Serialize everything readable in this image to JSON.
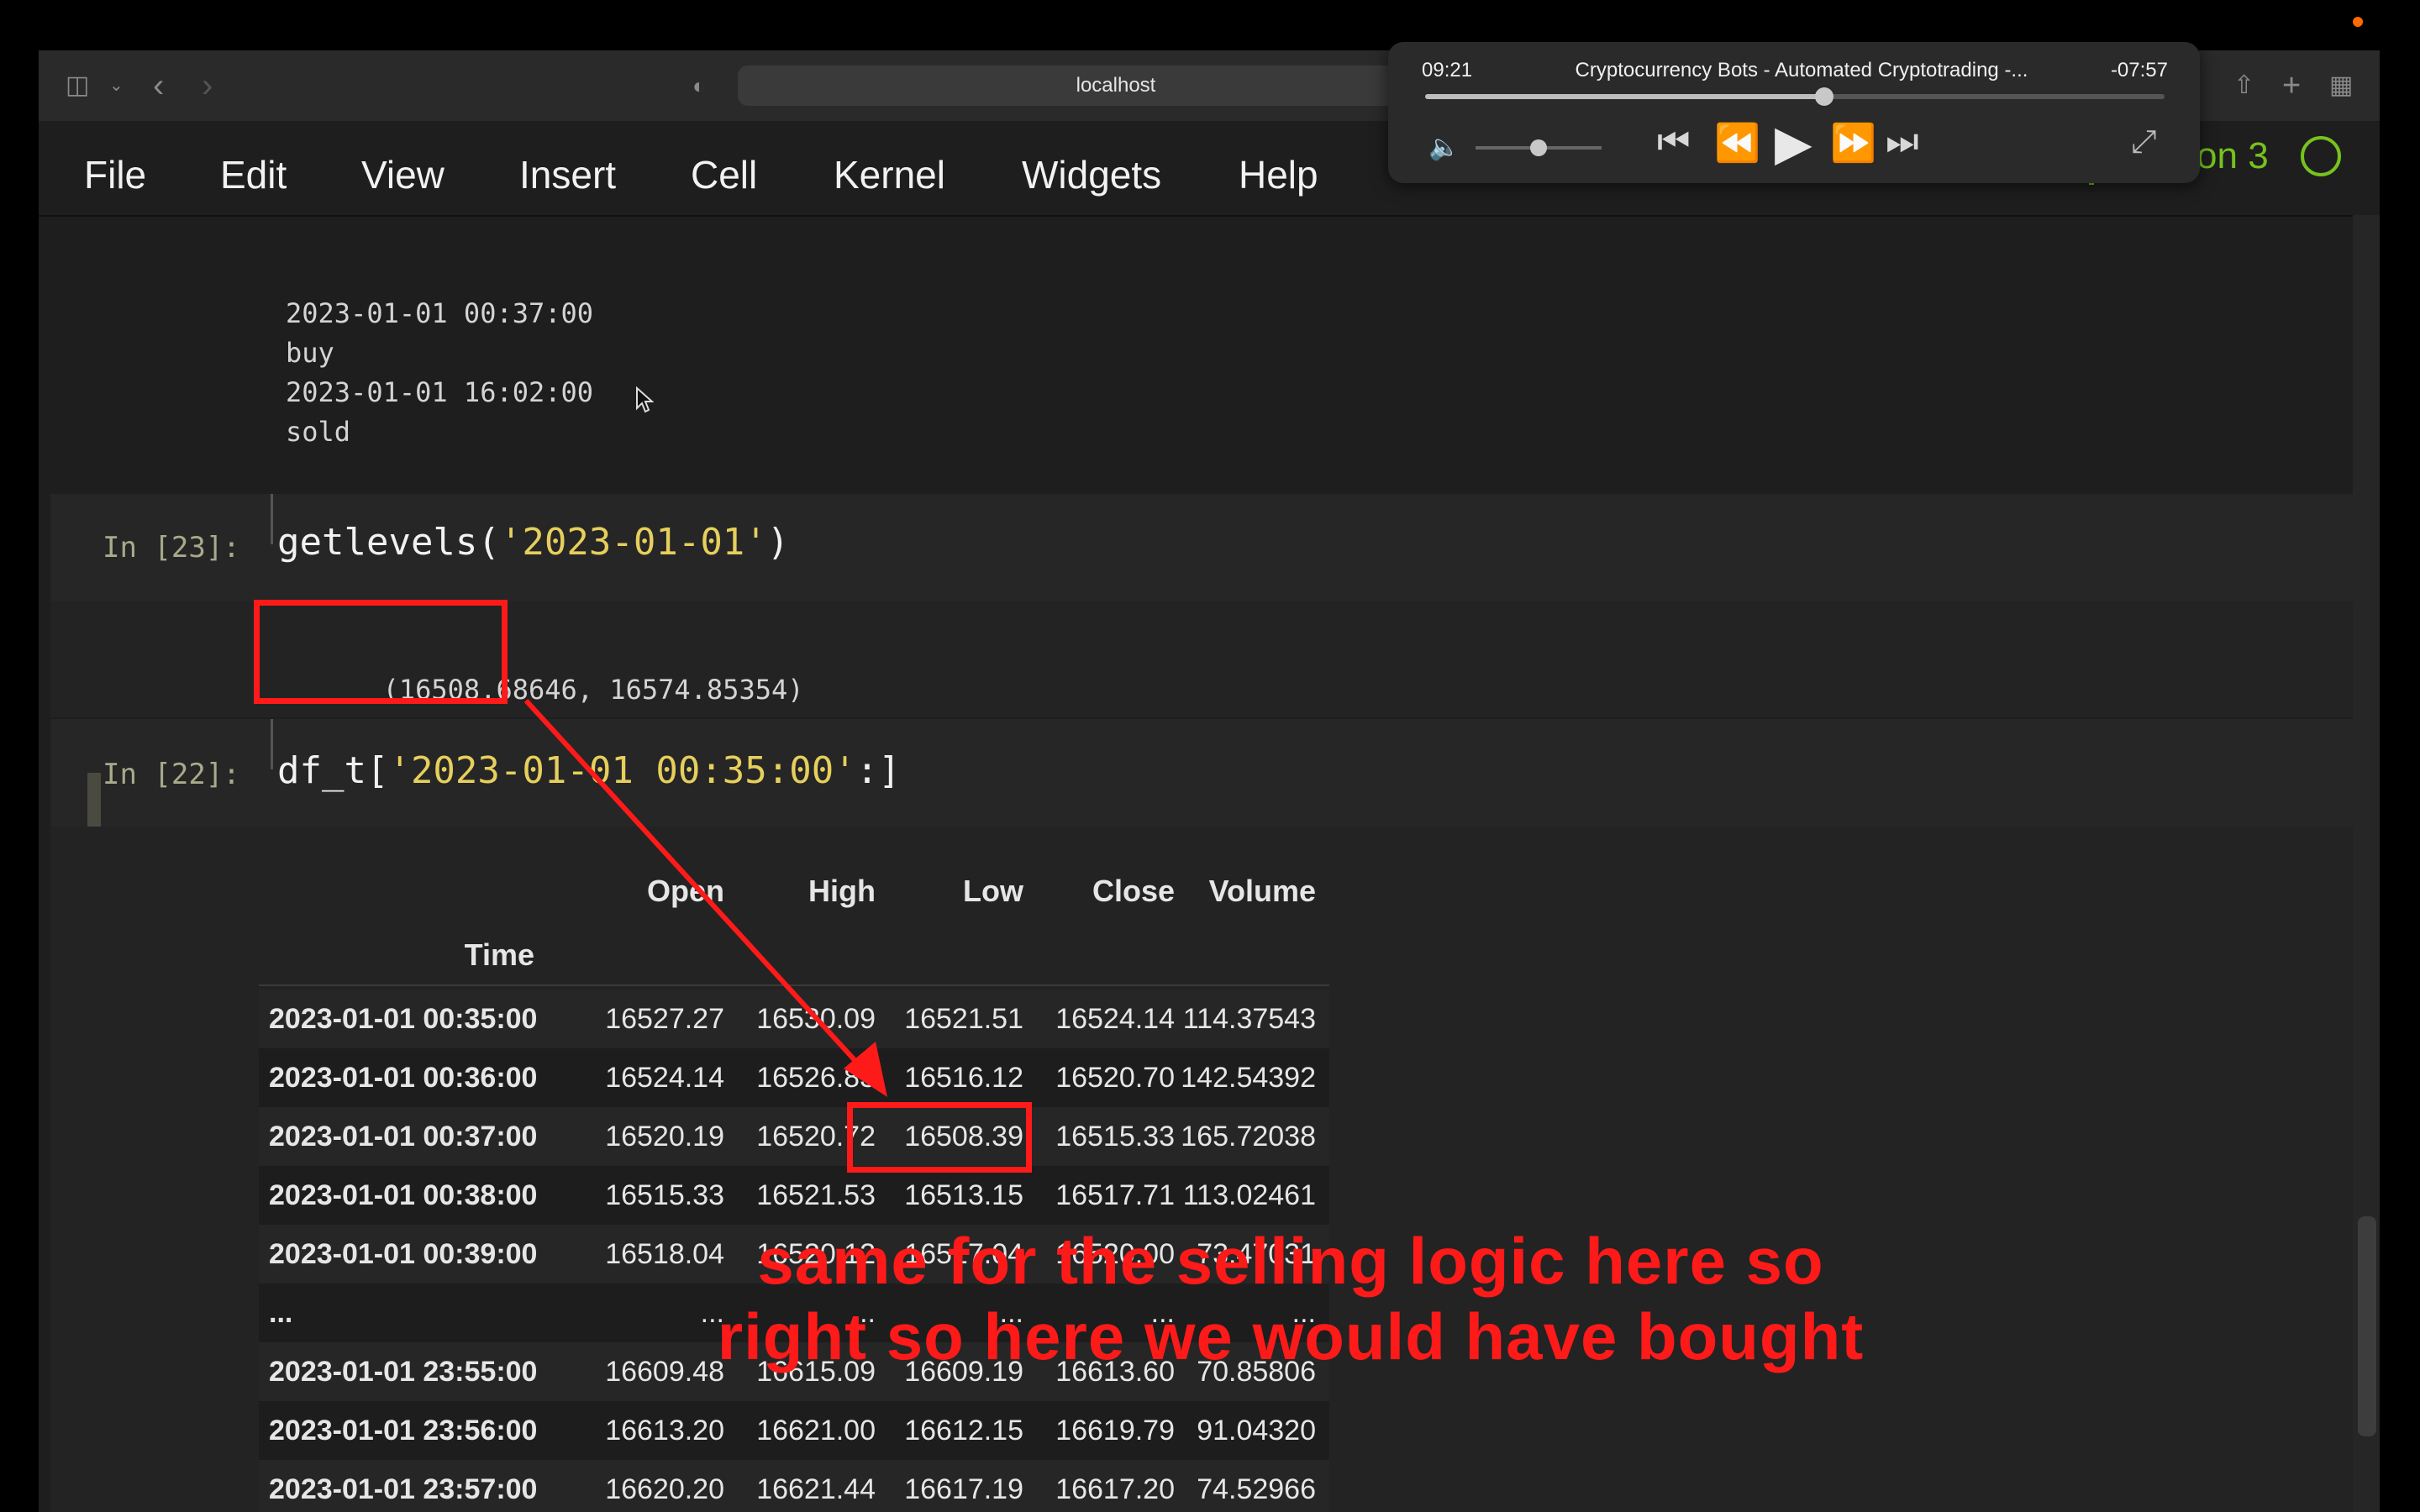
{
  "browser": {
    "url": "localhost"
  },
  "menu": {
    "items": [
      "File",
      "Edit",
      "View",
      "Insert",
      "Cell",
      "Kernel",
      "Widgets",
      "Help"
    ]
  },
  "kernel": {
    "name": "Python 3"
  },
  "output_prev": {
    "lines": [
      "2023-01-01 00:37:00",
      "buy",
      "2023-01-01 16:02:00",
      "sold"
    ]
  },
  "cell23": {
    "prompt": "In [23]:",
    "code_fn": "getlevels(",
    "code_arg": "'2023-01-01'",
    "code_close": ")",
    "output_a": "(16508.68646,",
    "output_b": " 16574.85354)"
  },
  "cell22": {
    "prompt": "In [22]:",
    "code_var": "df_t[",
    "code_arg": "'2023-01-01 00:35:00'",
    "code_close": ":]"
  },
  "table": {
    "columns": [
      "Open",
      "High",
      "Low",
      "Close",
      "Volume"
    ],
    "index_name": "Time",
    "rows": [
      [
        "2023-01-01 00:35:00",
        "16527.27",
        "16530.09",
        "16521.51",
        "16524.14",
        "114.37543"
      ],
      [
        "2023-01-01 00:36:00",
        "16524.14",
        "16526.83",
        "16516.12",
        "16520.70",
        "142.54392"
      ],
      [
        "2023-01-01 00:37:00",
        "16520.19",
        "16520.72",
        "16508.39",
        "16515.33",
        "165.72038"
      ],
      [
        "2023-01-01 00:38:00",
        "16515.33",
        "16521.53",
        "16513.15",
        "16517.71",
        "113.02461"
      ],
      [
        "2023-01-01 00:39:00",
        "16518.04",
        "16520.12",
        "16517.04",
        "16520.00",
        "73.47031"
      ],
      [
        "...",
        "...",
        "...",
        "...",
        "...",
        "..."
      ],
      [
        "2023-01-01 23:55:00",
        "16609.48",
        "16615.09",
        "16609.19",
        "16613.60",
        "70.85806"
      ],
      [
        "2023-01-01 23:56:00",
        "16613.20",
        "16621.00",
        "16612.15",
        "16619.79",
        "91.04320"
      ],
      [
        "2023-01-01 23:57:00",
        "16620.20",
        "16621.44",
        "16617.19",
        "16617.20",
        "74.52966"
      ]
    ]
  },
  "annotation": {
    "line1": "same for the selling logic here so",
    "line2": "right so here we would have bought"
  },
  "player": {
    "elapsed": "09:21",
    "title": "Cryptocurrency Bots - Automated Cryptotrading -...",
    "remaining": "-07:57",
    "progress": 0.54,
    "volume": 0.5
  },
  "colors": {
    "accent_red": "#ff1a1a",
    "kernel_green": "#77c21e",
    "string_yellow": "#e6cf5c"
  }
}
